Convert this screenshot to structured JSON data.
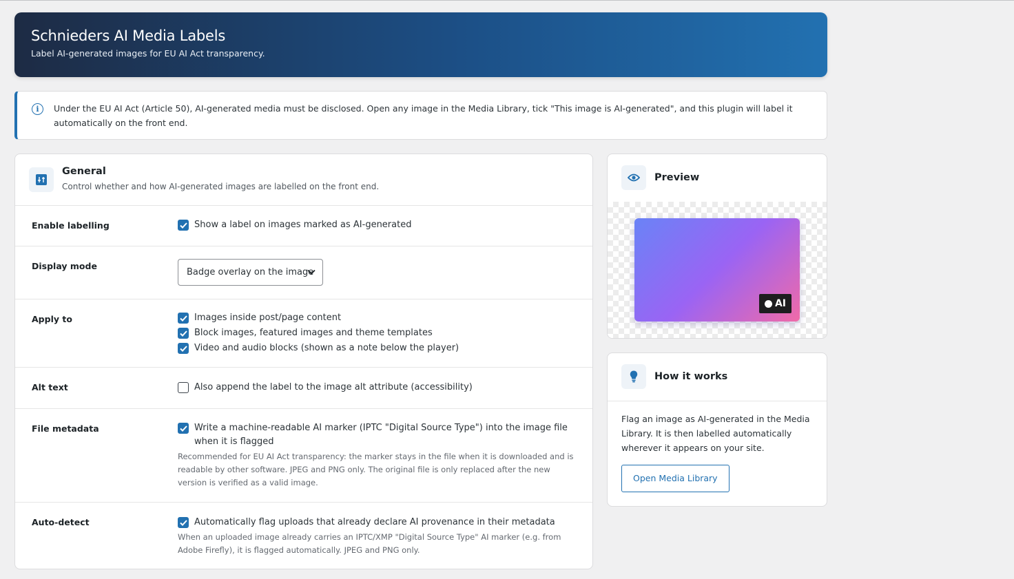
{
  "header": {
    "title": "Schnieders AI Media Labels",
    "subtitle": "Label AI-generated images for EU AI Act transparency."
  },
  "notice": {
    "icon": "info-icon",
    "text": "Under the EU AI Act (Article 50), AI-generated media must be disclosed. Open any image in the Media Library, tick \"This image is AI-generated\", and this plugin will label it automatically on the front end."
  },
  "general": {
    "icon": "sliders-icon",
    "title": "General",
    "subtitle": "Control whether and how AI-generated images are labelled on the front end.",
    "rows": {
      "enable": {
        "label": "Enable labelling",
        "checkbox": {
          "text": "Show a label on images marked as AI-generated",
          "checked": true
        }
      },
      "display_mode": {
        "label": "Display mode",
        "selected": "Badge overlay on the image"
      },
      "apply_to": {
        "label": "Apply to",
        "options": [
          {
            "text": "Images inside post/page content",
            "checked": true
          },
          {
            "text": "Block images, featured images and theme templates",
            "checked": true
          },
          {
            "text": "Video and audio blocks (shown as a note below the player)",
            "checked": true
          }
        ]
      },
      "alt_text": {
        "label": "Alt text",
        "checkbox": {
          "text": "Also append the label to the image alt attribute (accessibility)",
          "checked": false
        }
      },
      "file_metadata": {
        "label": "File metadata",
        "checkbox": {
          "text": "Write a machine-readable AI marker (IPTC \"Digital Source Type\") into the image file when it is flagged",
          "checked": true
        },
        "description": "Recommended for EU AI Act transparency: the marker stays in the file when it is downloaded and is readable by other software. JPEG and PNG only. The original file is only replaced after the new version is verified as a valid image."
      },
      "auto_detect": {
        "label": "Auto-detect",
        "checkbox": {
          "text": "Automatically flag uploads that already declare AI provenance in their metadata",
          "checked": true
        },
        "description": "When an uploaded image already carries an IPTC/XMP \"Digital Source Type\" AI marker (e.g. from Adobe Firefly), it is flagged automatically. JPEG and PNG only."
      }
    }
  },
  "preview": {
    "icon": "eye-icon",
    "title": "Preview",
    "badge_text": "AI"
  },
  "how_it_works": {
    "icon": "lightbulb-icon",
    "title": "How it works",
    "text": "Flag an image as AI-generated in the Media Library. It is then labelled automatically wherever it appears on your site.",
    "button_label": "Open Media Library"
  },
  "colors": {
    "accent": "#2271b1",
    "header_gradient_start": "#1d2b44",
    "header_gradient_end": "#2271b1",
    "preview_gradient": [
      "#6a83f6",
      "#9a64f4",
      "#f06aa8"
    ]
  }
}
